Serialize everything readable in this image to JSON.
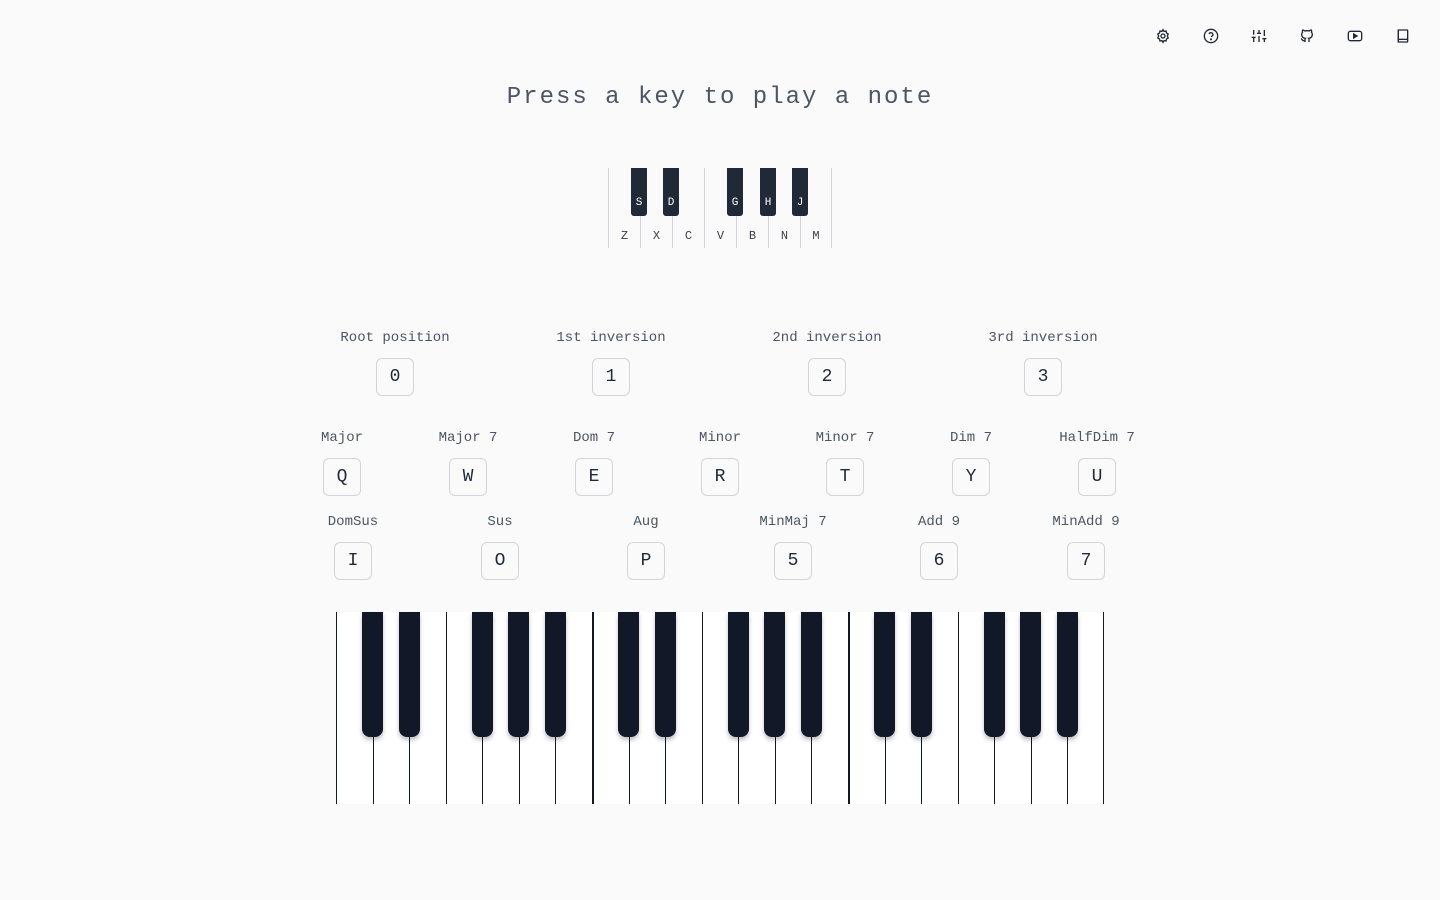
{
  "toolbar": {
    "icons": [
      "gear-icon",
      "help-circle-icon",
      "sliders-icon",
      "github-icon",
      "youtube-icon",
      "book-icon"
    ]
  },
  "headline": "Press a key to play a note",
  "mini_keyboard": {
    "white_keys": [
      "Z",
      "X",
      "C",
      "V",
      "B",
      "N",
      "M"
    ],
    "black_keys": [
      "S",
      "D",
      "G",
      "H",
      "J"
    ]
  },
  "inversions": [
    {
      "label": "Root position",
      "key": "0"
    },
    {
      "label": "1st inversion",
      "key": "1"
    },
    {
      "label": "2nd inversion",
      "key": "2"
    },
    {
      "label": "3rd inversion",
      "key": "3"
    }
  ],
  "chords_row1": [
    {
      "label": "Major",
      "key": "Q"
    },
    {
      "label": "Major 7",
      "key": "W"
    },
    {
      "label": "Dom 7",
      "key": "E"
    },
    {
      "label": "Minor",
      "key": "R"
    },
    {
      "label": "Minor 7",
      "key": "T"
    },
    {
      "label": "Dim 7",
      "key": "Y"
    },
    {
      "label": "HalfDim 7",
      "key": "U"
    }
  ],
  "chords_row2": [
    {
      "label": "DomSus",
      "key": "I"
    },
    {
      "label": "Sus",
      "key": "O"
    },
    {
      "label": "Aug",
      "key": "P"
    },
    {
      "label": "MinMaj 7",
      "key": "5"
    },
    {
      "label": "Add 9",
      "key": "6"
    },
    {
      "label": "MinAdd 9",
      "key": "7"
    }
  ],
  "piano": {
    "octaves": 3,
    "white_keys_per_octave": 7,
    "black_keys_per_octave": 5
  },
  "colors": {
    "background": "#fafafa",
    "black_key": "#111827",
    "text": "#4b5563"
  }
}
